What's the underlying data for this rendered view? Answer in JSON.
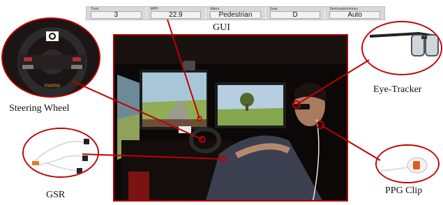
{
  "gui": {
    "fields": [
      {
        "label": "Trust",
        "value": "3"
      },
      {
        "label": "MPH",
        "value": "22.9"
      },
      {
        "label": "Alarm",
        "value": "Pedestrian"
      },
      {
        "label": "Gear",
        "value": "D"
      },
      {
        "label": "Semi-autonomous",
        "value": "Auto"
      }
    ]
  },
  "captions": {
    "gui": "GUI",
    "steering_wheel": "Steering Wheel",
    "eye_tracker": "Eye-Tracker",
    "gsr": "GSR",
    "ppg_clip": "PPG Clip"
  },
  "steering_wheel_logo": "momo",
  "colors": {
    "annotation": "#c00000",
    "gui_bg": "#d9d9d9"
  }
}
